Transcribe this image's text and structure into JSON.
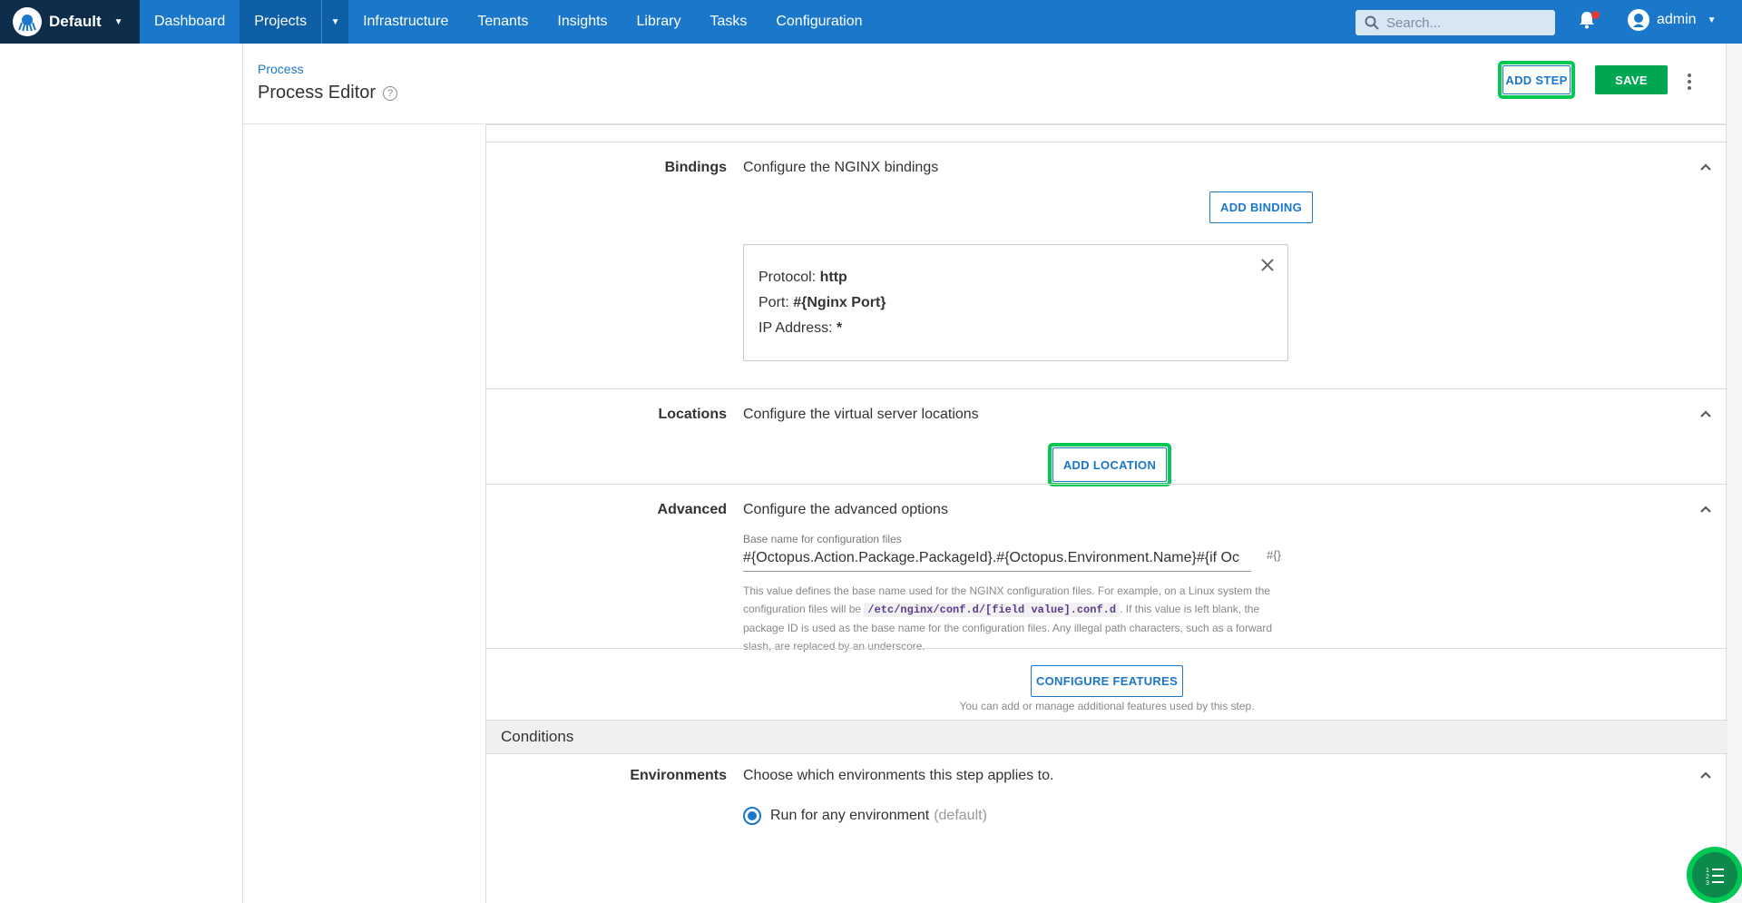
{
  "topnav": {
    "space_name": "Default",
    "items": [
      {
        "label": "Dashboard"
      },
      {
        "label": "Projects"
      },
      {
        "label": "Infrastructure"
      },
      {
        "label": "Tenants"
      },
      {
        "label": "Insights"
      },
      {
        "label": "Library"
      },
      {
        "label": "Tasks"
      },
      {
        "label": "Configuration"
      }
    ],
    "search_placeholder": "Search...",
    "user_name": "admin"
  },
  "header": {
    "breadcrumb": "Process",
    "title": "Process Editor",
    "add_step_label": "ADD STEP",
    "save_label": "SAVE"
  },
  "bindings": {
    "label": "Bindings",
    "description": "Configure the NGINX bindings",
    "add_label": "ADD BINDING",
    "card": {
      "protocol_key": "Protocol:",
      "protocol_value": "http",
      "port_key": "Port:",
      "port_value": "#{Nginx Port}",
      "ip_key": "IP Address:",
      "ip_value": "*"
    }
  },
  "locations": {
    "label": "Locations",
    "description": "Configure the virtual server locations",
    "add_label": "ADD LOCATION"
  },
  "advanced": {
    "label": "Advanced",
    "description": "Configure the advanced options",
    "field_label": "Base name for configuration files",
    "field_value": "#{Octopus.Action.Package.PackageId}.#{Octopus.Environment.Name}#{if Oc",
    "var_icon": "#{}",
    "help_part1": "This value defines the base name used for the NGINX configuration files. For example, on a Linux system the configuration files will be",
    "help_code": "/etc/nginx/conf.d/[field value].conf.d",
    "help_part2": ". If this value is left blank, the package ID is used as the base name for the configuration files. Any illegal path characters, such as a forward slash, are replaced by an underscore."
  },
  "features": {
    "button_label": "CONFIGURE FEATURES",
    "note": "You can add or manage additional features used by this step."
  },
  "conditions": {
    "title": "Conditions",
    "env_label": "Environments",
    "env_description": "Choose which environments this step applies to.",
    "radio_label": "Run for any environment",
    "radio_suffix": "(default)"
  },
  "colors": {
    "nav_blue": "#1a77ca",
    "space_dark": "#0d2d4a",
    "save_green": "#00a651",
    "highlight_green": "#00c853"
  }
}
